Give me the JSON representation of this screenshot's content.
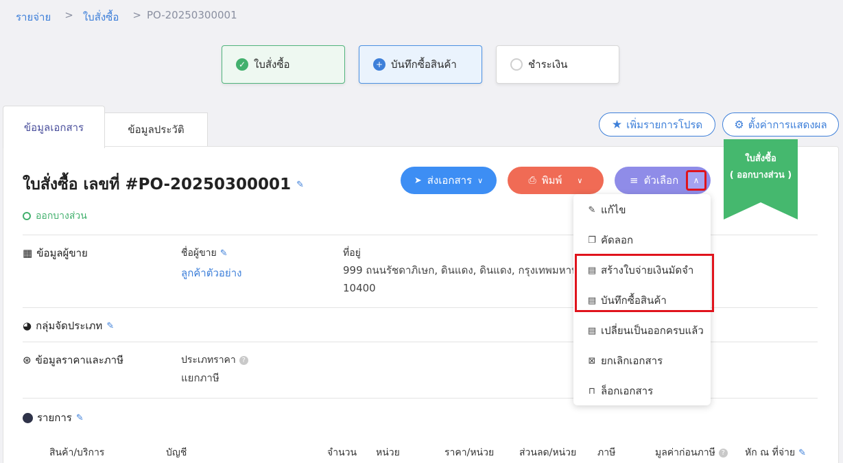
{
  "breadcrumb": [
    "รายจ่าย",
    "ใบสั่งซื้อ",
    "PO-20250300001"
  ],
  "steps": [
    "ใบสั่งซื้อ",
    "บันทึกซื้อสินค้า",
    "ชำระเงิน"
  ],
  "tabs": [
    "ข้อมูลเอกสาร",
    "ข้อมูลประวัติ"
  ],
  "top_buttons": {
    "favorite": "เพิ่มรายการโปรด",
    "display_settings": "ตั้งค่าการแสดงผล"
  },
  "ribbon": {
    "line1": "ใบสั่งซื้อ",
    "line2": "( ออกบางส่วน )"
  },
  "document": {
    "title": "ใบสั่งซื้อ เลขที่ #PO-20250300001",
    "status": "ออกบางส่วน"
  },
  "actions": {
    "send": "ส่งเอกสาร",
    "print": "พิมพ์",
    "options": "ตัวเลือก"
  },
  "options_menu": [
    "แก้ไข",
    "คัดลอก",
    "สร้างใบจ่ายเงินมัดจำ",
    "บันทึกซื้อสินค้า",
    "เปลี่ยนเป็นออกครบแล้ว",
    "ยกเลิกเอกสาร",
    "ล็อกเอกสาร"
  ],
  "vendor": {
    "section": "ข้อมูลผู้ขาย",
    "name_label": "ชื่อผู้ขาย",
    "name": "ลูกค้าตัวอย่าง",
    "address_label": "ที่อยู่",
    "address_line1": "999 ถนนรัชดาภิเษก, ดินแดง, ดินแดง, กรุงเทพมหานค",
    "address_line2": "10400"
  },
  "category": {
    "section": "กลุ่มจัดประเภท"
  },
  "pricing": {
    "section": "ข้อมูลราคาและภาษี",
    "price_type_label": "ประเภทราคา",
    "price_type": "แยกภาษี"
  },
  "items": {
    "section": "รายการ",
    "columns": [
      "สินค้า/บริการ",
      "บัญชี",
      "จำนวน",
      "หน่วย",
      "ราคา/หน่วย",
      "ส่วนลด/หน่วย",
      "ภาษี",
      "มูลค่าก่อนภาษี",
      "หัก ณ ที่จ่าย"
    ]
  },
  "colors": {
    "accent": "#3d7fd9",
    "green": "#42b06d",
    "send": "#3d8ef4",
    "print": "#f06b55",
    "options": "#8f8ce8",
    "highlight": "#e0131c"
  }
}
